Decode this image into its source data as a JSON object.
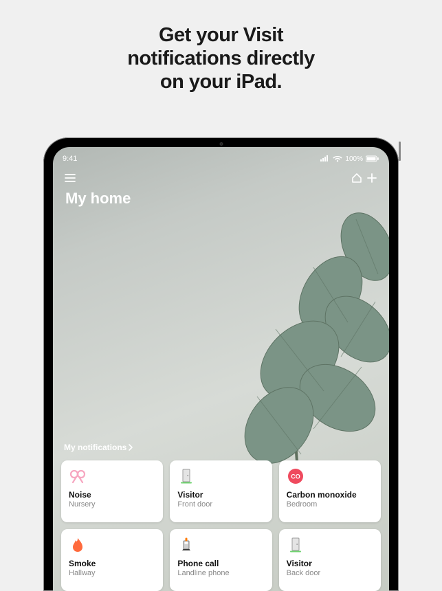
{
  "promo": {
    "line1": "Get your Visit",
    "line2": "notifications directly",
    "line3": "on your iPad."
  },
  "status_bar": {
    "time": "9:41",
    "battery_label": "100%"
  },
  "header": {
    "title": "My home"
  },
  "section": {
    "label": "My notifications"
  },
  "cards": [
    {
      "icon": "noise",
      "title": "Noise",
      "sub": "Nursery"
    },
    {
      "icon": "door",
      "title": "Visitor",
      "sub": "Front door"
    },
    {
      "icon": "co",
      "title": "Carbon monoxide",
      "sub": "Bedroom",
      "badge": "CO"
    },
    {
      "icon": "flame",
      "title": "Smoke",
      "sub": "Hallway"
    },
    {
      "icon": "phone",
      "title": "Phone call",
      "sub": "Landline phone"
    },
    {
      "icon": "door",
      "title": "Visitor",
      "sub": "Back door"
    }
  ]
}
